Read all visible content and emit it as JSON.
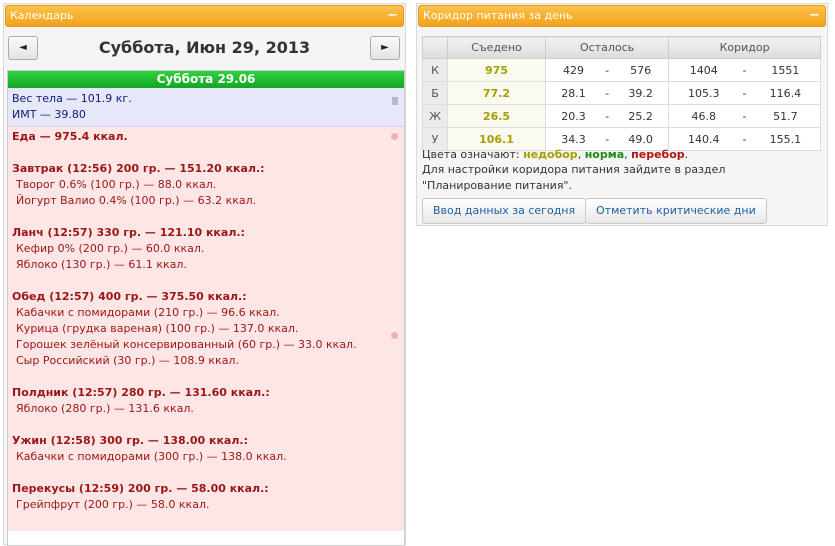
{
  "calendar": {
    "header": "Календарь",
    "collapse": "−",
    "prev": "◄",
    "next": "►",
    "date_title": "Суббота, Июн 29, 2013",
    "day_label": "Суббота 29.06",
    "weight": "Вес тела — 101.9 кг.",
    "bmi": "ИМТ — 39.80",
    "food_total": "Еда — 975.4 ккал.",
    "meals": [
      {
        "title": "Завтрак (12:56) 200 гр. — 151.20 ккал.:",
        "items": [
          "Творог 0.6% (100 гр.) — 88.0 ккал.",
          "Йогурт Валио 0.4% (100 гр.) — 63.2 ккал."
        ]
      },
      {
        "title": "Ланч (12:57) 330 гр. — 121.10 ккал.:",
        "items": [
          "Кефир 0% (200 гр.) — 60.0 ккал.",
          "Яблоко (130 гр.) — 61.1 ккал."
        ]
      },
      {
        "title": "Обед (12:57) 400 гр. — 375.50 ккал.:",
        "items": [
          "Кабачки с помидорами (210 гр.) — 96.6 ккал.",
          "Курица (грудка вареная) (100 гр.) — 137.0 ккал.",
          "Горошек зелёный консервированный (60 гр.) — 33.0 ккал.",
          "Сыр Российский (30 гр.) — 108.9 ккал."
        ]
      },
      {
        "title": "Полдник (12:57) 280 гр. — 131.60 ккал.:",
        "items": [
          "Яблоко (280 гр.) — 131.6 ккал."
        ]
      },
      {
        "title": "Ужин (12:58) 300 гр. — 138.00 ккал.:",
        "items": [
          "Кабачки с помидорами (300 гр.) — 138.0 ккал."
        ]
      },
      {
        "title": "Перекусы (12:59) 200 гр. — 58.00 ккал.:",
        "items": [
          "Грейпфрут (200 гр.) — 58.0 ккал."
        ]
      }
    ]
  },
  "corridor": {
    "header": "Коридор питания за день",
    "collapse": "−",
    "columns": [
      "",
      "Съедено",
      "Осталось",
      "Коридор"
    ],
    "rows": [
      {
        "label": "К",
        "eaten": "975",
        "left_min": "429",
        "left_max": "576",
        "corr_min": "1404",
        "corr_max": "1551"
      },
      {
        "label": "Б",
        "eaten": "77.2",
        "left_min": "28.1",
        "left_max": "39.2",
        "corr_min": "105.3",
        "corr_max": "116.4"
      },
      {
        "label": "Ж",
        "eaten": "26.5",
        "left_min": "20.3",
        "left_max": "25.2",
        "corr_min": "46.8",
        "corr_max": "51.7"
      },
      {
        "label": "У",
        "eaten": "106.1",
        "left_min": "34.3",
        "left_max": "49.0",
        "corr_min": "140.4",
        "corr_max": "155.1"
      }
    ],
    "dash": "-",
    "legend_prefix": "Цвета означают:",
    "legend_under": "недобор",
    "legend_norm": "норма",
    "legend_over": "перебор",
    "legend_sep": ",",
    "legend_end": ".",
    "note": "Для настройки коридора питания зайдите в раздел \"Планирование питания\".",
    "btn_enter": "Ввод данных за сегодня",
    "btn_critical": "Отметить критические дни"
  }
}
